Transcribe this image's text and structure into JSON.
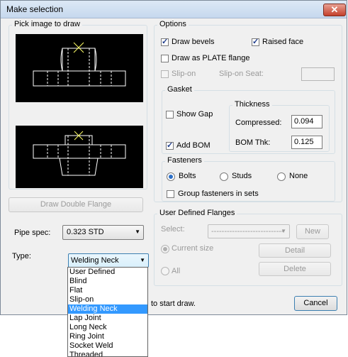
{
  "window": {
    "title": "Make selection",
    "close_glyph": "✕"
  },
  "pick_image": {
    "label": "Pick image to draw",
    "draw_double_flange": "Draw Double Flange"
  },
  "pipe_spec": {
    "label": "Pipe spec:",
    "value": "0.323     STD"
  },
  "type": {
    "label": "Type:",
    "value": "Welding Neck",
    "options": [
      "User Defined",
      "Blind",
      "Flat",
      "Slip-on",
      "Welding Neck",
      "Lap Joint",
      "Long Neck",
      "Ring Joint",
      "Socket Weld",
      "Threaded"
    ],
    "selected_index": 4
  },
  "options": {
    "label": "Options",
    "draw_bevels": {
      "label": "Draw bevels",
      "checked": true
    },
    "raised_face": {
      "label": "Raised face",
      "checked": true
    },
    "draw_as_plate": {
      "label": "Draw as PLATE flange",
      "checked": false
    },
    "slip_on": {
      "label": "Slip-on",
      "checked": false,
      "disabled": true
    },
    "slip_on_seat": {
      "label": "Slip-on Seat:",
      "value": ""
    },
    "gasket": {
      "label": "Gasket",
      "show_gap": {
        "label": "Show Gap",
        "checked": false
      },
      "add_bom": {
        "label": "Add BOM",
        "checked": true
      },
      "thickness": {
        "label": "Thickness",
        "compressed": {
          "label": "Compressed:",
          "value": "0.094"
        },
        "bom_thk": {
          "label": "BOM Thk:",
          "value": "0.125"
        }
      }
    },
    "fasteners": {
      "label": "Fasteners",
      "bolts": "Bolts",
      "studs": "Studs",
      "none": "None",
      "selected": "Bolts",
      "group_in_sets": {
        "label": "Group fasteners in sets",
        "checked": false
      }
    }
  },
  "user_defined": {
    "label": "User Defined Flanges",
    "select_label": "Select:",
    "select_value": "----------------------------",
    "new_button": "New",
    "current_size": "Current size",
    "all": "All",
    "detail_button": "Detail",
    "delete_button": "Delete"
  },
  "footer": {
    "hint": "to start draw.",
    "cancel_button": "Cancel"
  },
  "colors": {
    "canvas": "#000000",
    "flange_lines": "#ffffff",
    "crosshair": "#ffff66",
    "selection": "#3399ff"
  }
}
